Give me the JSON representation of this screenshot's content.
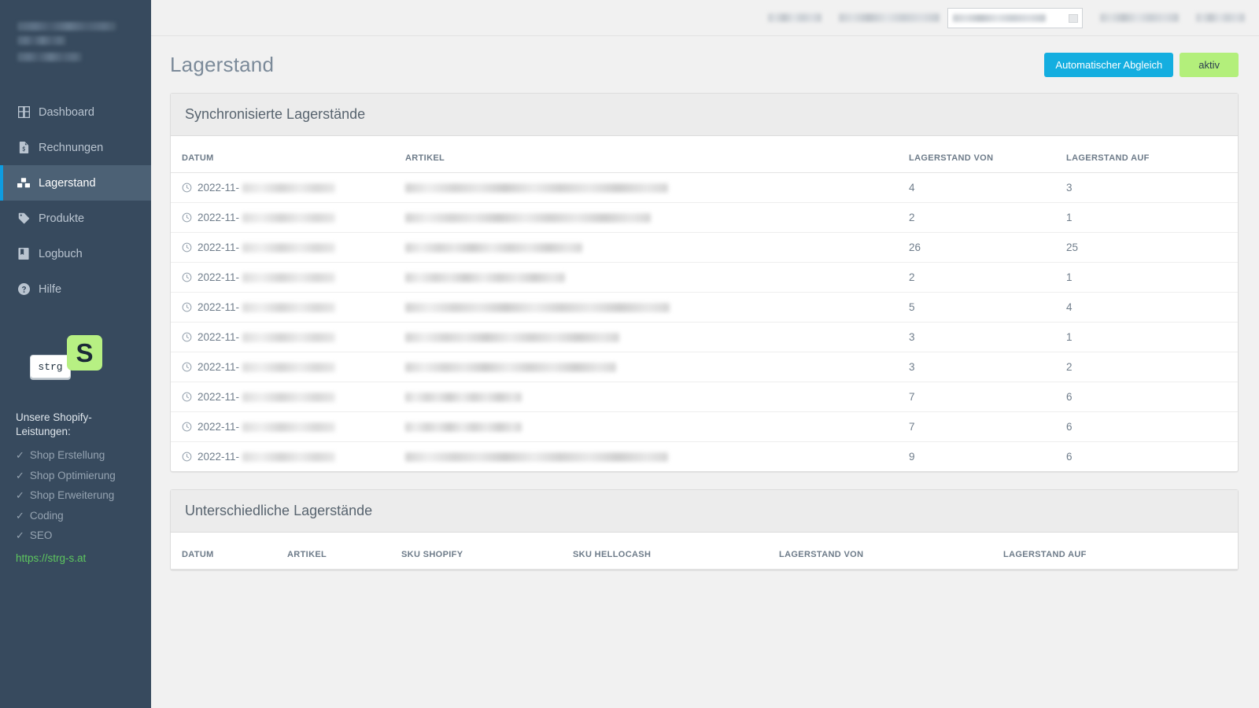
{
  "sidebar": {
    "brand_lines": [
      "",
      "",
      ""
    ],
    "nav": [
      {
        "label": "Dashboard",
        "icon": "grid-icon",
        "active": false
      },
      {
        "label": "Rechnungen",
        "icon": "invoice-icon",
        "active": false
      },
      {
        "label": "Lagerstand",
        "icon": "boxes-icon",
        "active": true
      },
      {
        "label": "Produkte",
        "icon": "tag-icon",
        "active": false
      },
      {
        "label": "Logbuch",
        "icon": "book-icon",
        "active": false
      },
      {
        "label": "Hilfe",
        "icon": "question-circle-icon",
        "active": false
      }
    ],
    "logo": {
      "letter": "S",
      "key_label": "strg",
      "green": "#b7f083"
    },
    "promo": {
      "title": "Unsere Shopify-Leistungen:",
      "items": [
        "Shop Erstellung",
        "Shop Optimierung",
        "Shop Erweiterung",
        "Coding",
        "SEO"
      ],
      "check_glyph": "✓",
      "link": "https://strg-s.at",
      "link_color": "#5ec85e"
    }
  },
  "topbar": {
    "items": [
      "",
      "",
      "",
      ""
    ],
    "select_value": ""
  },
  "page": {
    "title": "Lagerstand",
    "actions": {
      "primary_label": "Automatischer Abgleich",
      "status_label": "aktiv",
      "primary_color": "#14aee0",
      "status_color": "#b3ef7b"
    }
  },
  "panel_synced": {
    "title": "Synchronisierte Lagerstände",
    "columns": [
      "DATUM",
      "ARTIKEL",
      "LAGERSTAND VON",
      "LAGERSTAND AUF"
    ],
    "rows": [
      {
        "date_prefix": "2022-11-",
        "date_blur_width": 118,
        "article_blur_width": 334,
        "von": "4",
        "auf": "3"
      },
      {
        "date_prefix": "2022-11-",
        "date_blur_width": 118,
        "article_blur_width": 312,
        "von": "2",
        "auf": "1"
      },
      {
        "date_prefix": "2022-11-",
        "date_blur_width": 118,
        "article_blur_width": 225,
        "von": "26",
        "auf": "25"
      },
      {
        "date_prefix": "2022-11-",
        "date_blur_width": 118,
        "article_blur_width": 203,
        "von": "2",
        "auf": "1"
      },
      {
        "date_prefix": "2022-11-",
        "date_blur_width": 118,
        "article_blur_width": 336,
        "von": "5",
        "auf": "4"
      },
      {
        "date_prefix": "2022-11-",
        "date_blur_width": 118,
        "article_blur_width": 272,
        "von": "3",
        "auf": "1"
      },
      {
        "date_prefix": "2022-11-",
        "date_blur_width": 118,
        "article_blur_width": 268,
        "von": "3",
        "auf": "2"
      },
      {
        "date_prefix": "2022-11-",
        "date_blur_width": 118,
        "article_blur_width": 148,
        "von": "7",
        "auf": "6"
      },
      {
        "date_prefix": "2022-11-",
        "date_blur_width": 118,
        "article_blur_width": 148,
        "von": "7",
        "auf": "6"
      },
      {
        "date_prefix": "2022-11-",
        "date_blur_width": 118,
        "article_blur_width": 334,
        "von": "9",
        "auf": "6"
      }
    ]
  },
  "panel_diff": {
    "title": "Unterschiedliche Lagerstände",
    "columns": [
      "DATUM",
      "ARTIKEL",
      "SKU SHOPIFY",
      "SKU HELLOCASH",
      "LAGERSTAND VON",
      "LAGERSTAND AUF"
    ],
    "rows": []
  }
}
